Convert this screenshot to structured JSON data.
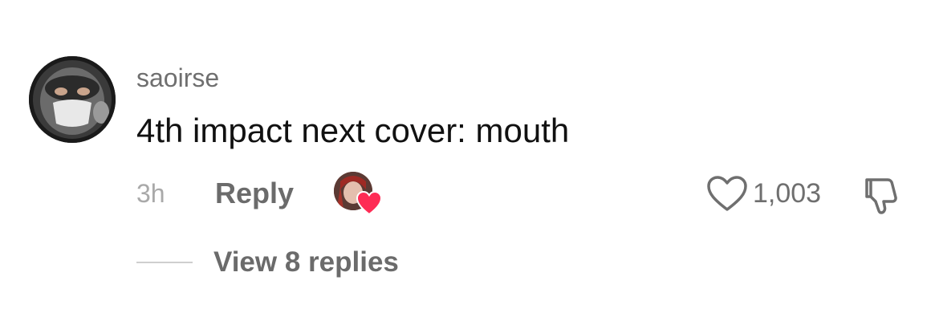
{
  "comment": {
    "username": "saoirse",
    "text": "4th impact next cover: mouth",
    "timestamp": "3h",
    "reply_label": "Reply",
    "like_count": "1,003",
    "liked_by_creator": true,
    "view_replies_label": "View 8 replies"
  },
  "icons": {
    "like": "heart-outline-icon",
    "dislike": "thumbs-down-icon",
    "creator_like": "creator-heart-badge-icon"
  },
  "colors": {
    "heart_red": "#fe2c55",
    "secondary_text": "#6f6f6f",
    "muted_text": "#a9a9a9",
    "primary_text": "#111111"
  }
}
